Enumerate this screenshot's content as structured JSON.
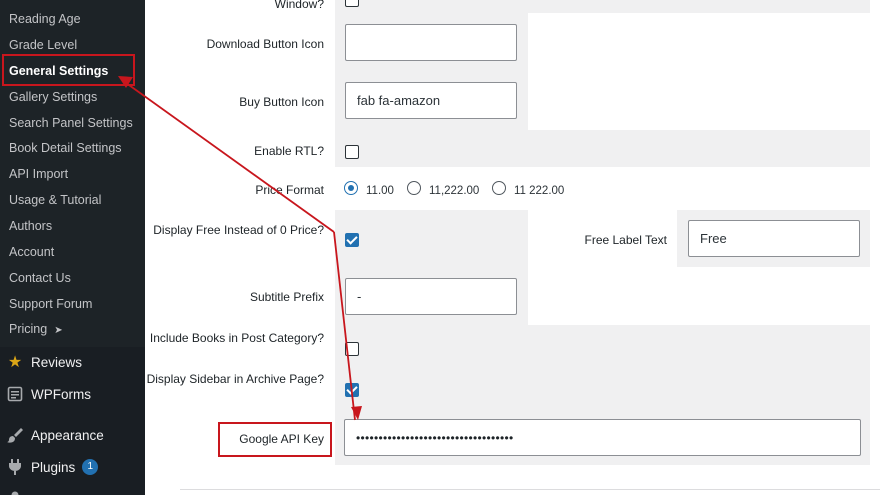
{
  "sidebar": {
    "items": [
      {
        "label": "Reading Age"
      },
      {
        "label": "Grade Level"
      },
      {
        "label": "General Settings"
      },
      {
        "label": "Gallery Settings"
      },
      {
        "label": "Search Panel Settings"
      },
      {
        "label": "Book Detail Settings"
      },
      {
        "label": "API Import"
      },
      {
        "label": "Usage & Tutorial"
      },
      {
        "label": "Authors"
      },
      {
        "label": "Account"
      },
      {
        "label": "Contact Us"
      },
      {
        "label": "Support Forum"
      },
      {
        "label": "Pricing"
      }
    ],
    "menu": [
      {
        "label": "Reviews",
        "icon": "star-icon"
      },
      {
        "label": "WPForms",
        "icon": "wpforms-icon"
      },
      {
        "label": "Appearance",
        "icon": "paintbrush-icon"
      },
      {
        "label": "Plugins",
        "icon": "plugin-icon",
        "badge": "1"
      }
    ]
  },
  "form": {
    "window_label": "Window?",
    "download_icon_label": "Download Button Icon",
    "download_icon_value": "",
    "buy_icon_label": "Buy Button Icon",
    "buy_icon_value": "fab fa-amazon",
    "rtl_label": "Enable RTL?",
    "rtl_checked": false,
    "price_format_label": "Price Format",
    "price_formats": [
      {
        "label": "11.00",
        "selected": true
      },
      {
        "label": "11,222.00",
        "selected": false
      },
      {
        "label": "11 222.00",
        "selected": false
      }
    ],
    "display_free_label": "Display Free Instead of 0 Price?",
    "display_free_checked": true,
    "free_label_text_label": "Free Label Text",
    "free_label_value": "Free",
    "subtitle_prefix_label": "Subtitle Prefix",
    "subtitle_prefix_value": "-",
    "include_books_label": "Include Books in Post Category?",
    "include_books_checked": false,
    "display_sidebar_label": "Display Sidebar in Archive Page?",
    "display_sidebar_checked": true,
    "google_api_label": "Google API Key",
    "google_api_value": "•••••••••••••••••••••••••••••••••••"
  },
  "colors": {
    "sidebar_bg": "#1d2327",
    "accent": "#2271b1",
    "annotation_red": "#c8161d",
    "cell_bg": "#f0f0f1"
  }
}
